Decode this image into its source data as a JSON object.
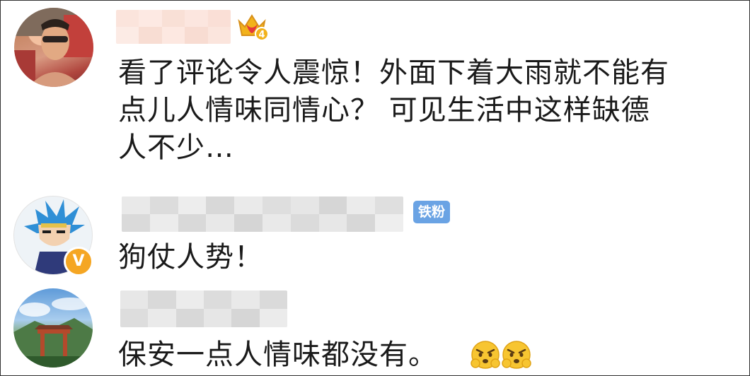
{
  "comments": [
    {
      "text_lines": [
        "看了评论令人震惊！外面下着大雨就不能有",
        "点儿人情味同情心？ 可见生活中这样缺德",
        "人不少…"
      ],
      "badge_icon": "crown-vip-level-icon",
      "badge_level": "4"
    },
    {
      "text": "狗仗人势！",
      "badge_label": "铁粉",
      "verified_mark": "V"
    },
    {
      "text": "保安一点人情味都没有。",
      "emoji": [
        "angry-face-emoji",
        "angry-face-emoji"
      ]
    }
  ],
  "colors": {
    "text": "#1a1a1a",
    "fans_badge": "#6aa3e4",
    "verified": "#f5a623",
    "crown": "#f2b21b"
  }
}
